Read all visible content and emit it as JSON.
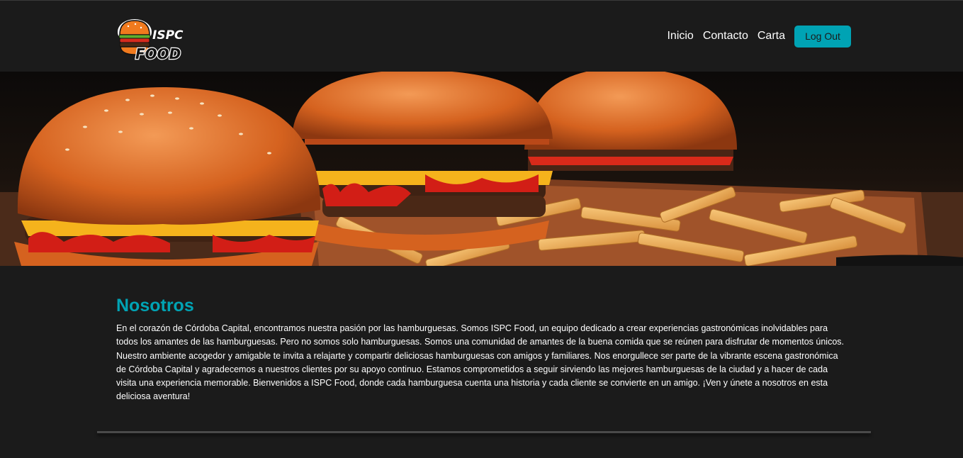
{
  "header": {
    "logo": {
      "text_top": "ISPC",
      "text_bottom": "FOOD"
    },
    "nav": [
      {
        "label": "Inicio"
      },
      {
        "label": "Contacto"
      },
      {
        "label": "Carta"
      }
    ],
    "logout_label": "Log Out"
  },
  "hero": {
    "image": "hamburgers-and-fries-photo"
  },
  "about": {
    "title": "Nosotros",
    "text": "En el corazón de Córdoba Capital, encontramos nuestra pasión por las hamburguesas. Somos ISPC Food, un equipo dedicado a crear experiencias gastronómicas inolvidables para todos los amantes de las hamburguesas. Pero no somos solo hamburguesas. Somos una comunidad de amantes de la buena comida que se reúnen para disfrutar de momentos únicos. Nuestro ambiente acogedor y amigable te invita a relajarte y compartir deliciosas hamburguesas con amigos y familiares. Nos enorgullece ser parte de la vibrante escena gastronómica de Córdoba Capital y agradecemos a nuestros clientes por su apoyo continuo. Estamos comprometidos a seguir sirviendo las mejores hamburguesas de la ciudad y a hacer de cada visita una experiencia memorable. Bienvenidos a ISPC Food, donde cada hamburguesa cuenta una historia y cada cliente se convierte en un amigo. ¡Ven y únete a nosotros en esta deliciosa aventura!"
  },
  "colors": {
    "background": "#1b1b1b",
    "accent": "#00a3b4",
    "text": "#ffffff"
  }
}
